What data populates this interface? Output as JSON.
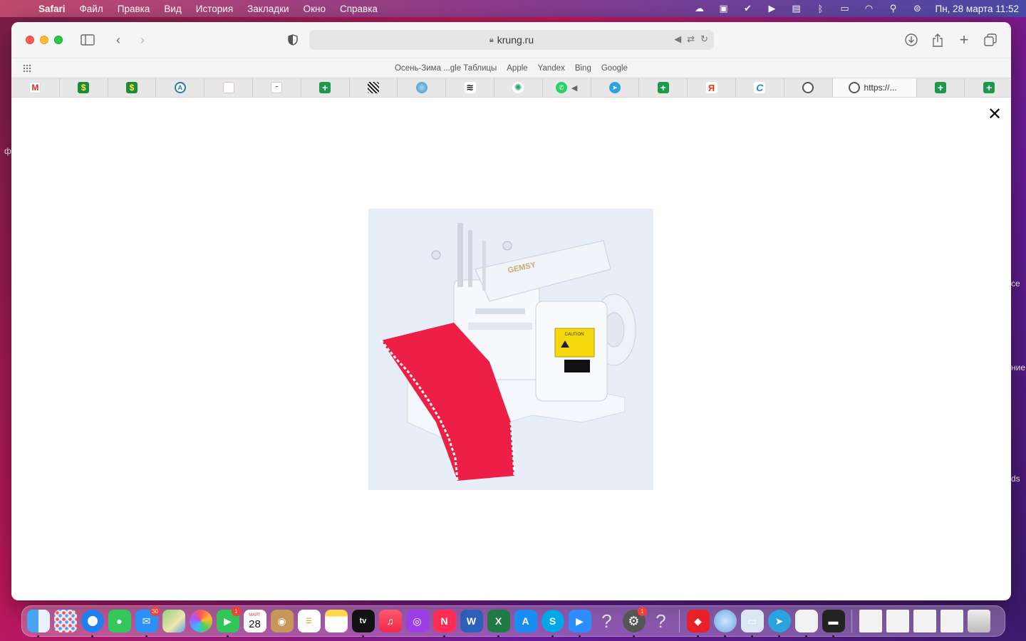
{
  "menubar": {
    "app_name": "Safari",
    "menu_items": [
      "Файл",
      "Правка",
      "Вид",
      "История",
      "Закладки",
      "Окно",
      "Справка"
    ],
    "clock": "Пн, 28 марта  11:52"
  },
  "desktop_fragments": [
    "ф",
    "се",
    "ние",
    "ds"
  ],
  "browser": {
    "url": "krung.ru",
    "favorites": [
      "Осень-Зима ...gle Таблицы",
      "Apple",
      "Yandex",
      "Bing",
      "Google"
    ],
    "active_tab_title": "https://...",
    "tab_icons": [
      "gmail-icon",
      "dollar-icon",
      "dollar-icon",
      "circle-a-icon",
      "document-icon",
      "notion-icon",
      "sheets-plus-icon",
      "checker-icon",
      "globe-icon",
      "layers-icon",
      "gear-icon",
      "whatsapp-icon",
      "telegram-icon",
      "sheets-plus-icon",
      "yandex-icon",
      "c-icon",
      "ring-icon"
    ],
    "tab_glyphs": [
      "M",
      "$",
      "$",
      "A",
      "",
      "~",
      "+",
      "",
      "",
      "≋",
      "✺",
      "✆",
      "➤",
      "+",
      "Я",
      "C",
      ""
    ]
  },
  "lightbox": {
    "close_label": "✕",
    "product_brand": "GEMSY",
    "caution_label": "CAUTION"
  },
  "dock": {
    "calendar_month": "МАРТ",
    "calendar_day": "28",
    "mail_badge": "30",
    "facetime_badge": "1",
    "settings_badge": "1",
    "tv_label": "tv"
  }
}
